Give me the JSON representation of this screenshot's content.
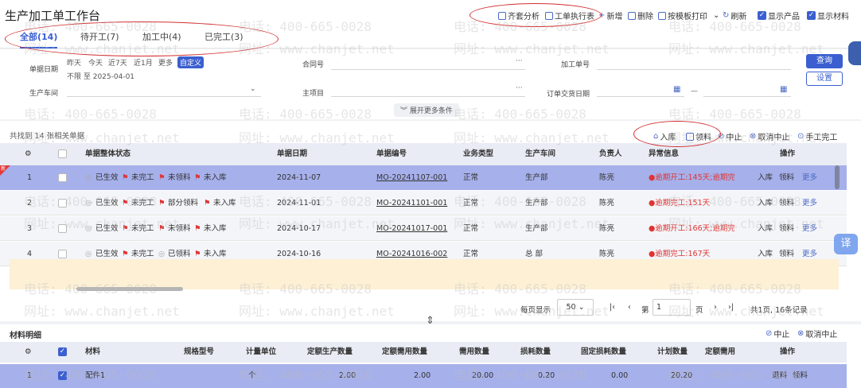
{
  "page_title": "生产加工单工作台",
  "toolbar": {
    "items": [
      "齐套分析",
      "工单执行表",
      "新增",
      "删除",
      "按模板打印",
      "刷新"
    ],
    "show_product": "显示产品",
    "show_material": "显示材料"
  },
  "tabs": [
    {
      "label": "全部(14)",
      "active": true
    },
    {
      "label": "待开工(7)",
      "active": false
    },
    {
      "label": "加工中(4)",
      "active": false
    },
    {
      "label": "已完工(3)",
      "active": false
    }
  ],
  "filters": {
    "doc_date_label": "单据日期",
    "date_chips": [
      "昨天",
      "今天",
      "近7天",
      "近1月",
      "更多"
    ],
    "custom_chip": "自定义",
    "date_range_text": "不限 至 2025-04-01",
    "contract_label": "合同号",
    "order_no_label": "加工单号",
    "workshop_label": "生产车间",
    "main_item_label": "主项目",
    "delivery_label": "订单交货日期",
    "range_dash": "—",
    "ellipsis": "···",
    "expand_label": "展开更多条件",
    "query_button": "查询",
    "settings_button": "设置"
  },
  "result": {
    "count_text": "共找到 14 张相关单据",
    "actions": [
      "入库",
      "领料",
      "中止",
      "取消中止",
      "手工完工"
    ]
  },
  "table": {
    "columns": [
      "单据整体状态",
      "单据日期",
      "单据编号",
      "业务类型",
      "生产车间",
      "负责人",
      "异常信息",
      "操作"
    ],
    "rows": [
      {
        "no": "1",
        "s1": "已生效",
        "s2": "未完工",
        "s3": "未领料",
        "s4": "未入库",
        "date": "2024-11-07",
        "code": "MO-20241107-001",
        "type": "正常",
        "shop": "生产部",
        "owner": "陈亮",
        "err": "逾期开工:145天;逾期完",
        "ops": [
          "入库",
          "领料",
          "更多"
        ]
      },
      {
        "no": "2",
        "s1": "已生效",
        "s2": "未完工",
        "s3": "部分领料",
        "s4": "未入库",
        "date": "2024-11-01",
        "code": "MO-20241101-001",
        "type": "正常",
        "shop": "生产部",
        "owner": "陈亮",
        "err": "逾期完工:151天",
        "ops": [
          "入库",
          "领料",
          "更多"
        ]
      },
      {
        "no": "3",
        "s1": "已生效",
        "s2": "未完工",
        "s3": "未领料",
        "s4": "未入库",
        "date": "2024-10-17",
        "code": "MO-20241017-001",
        "type": "正常",
        "shop": "生产部",
        "owner": "陈亮",
        "err": "逾期开工:166天;逾期完",
        "ops": [
          "入库",
          "领料",
          "更多"
        ]
      },
      {
        "no": "4",
        "s1": "已生效",
        "s2": "未完工",
        "s3": "已领料",
        "s4": "未入库",
        "date": "2024-10-16",
        "code": "MO-20241016-002",
        "type": "正常",
        "shop": "总 部",
        "owner": "陈亮",
        "err": "逾期完工:167天",
        "ops": [
          "入库",
          "领料",
          "更多"
        ]
      }
    ],
    "new_badge": "新"
  },
  "pagination": {
    "per_page_label": "每页显示",
    "per_page": "50",
    "page_prefix": "第",
    "page": "1",
    "page_suffix": "页",
    "summary": "共1页, 16条记录"
  },
  "materials": {
    "title": "材料明细",
    "actions": [
      "中止",
      "取消中止"
    ],
    "columns": [
      "材料",
      "规格型号",
      "计量单位",
      "定额生产数量",
      "定额需用数量",
      "需用数量",
      "损耗数量",
      "固定损耗数量",
      "计划数量",
      "定额需用",
      "操作"
    ],
    "row": {
      "no": "1",
      "name": "配件1",
      "unit": "个",
      "q1": "2.00",
      "q2": "2.00",
      "q3": "20.00",
      "q4": "0.20",
      "q5": "0.00",
      "q6": "20.20",
      "ops": [
        "退料",
        "领料"
      ]
    }
  },
  "watermark": {
    "phone": "电话: 400-665-0028",
    "site": "网址: www.chanjet.net"
  },
  "float_button": "译"
}
